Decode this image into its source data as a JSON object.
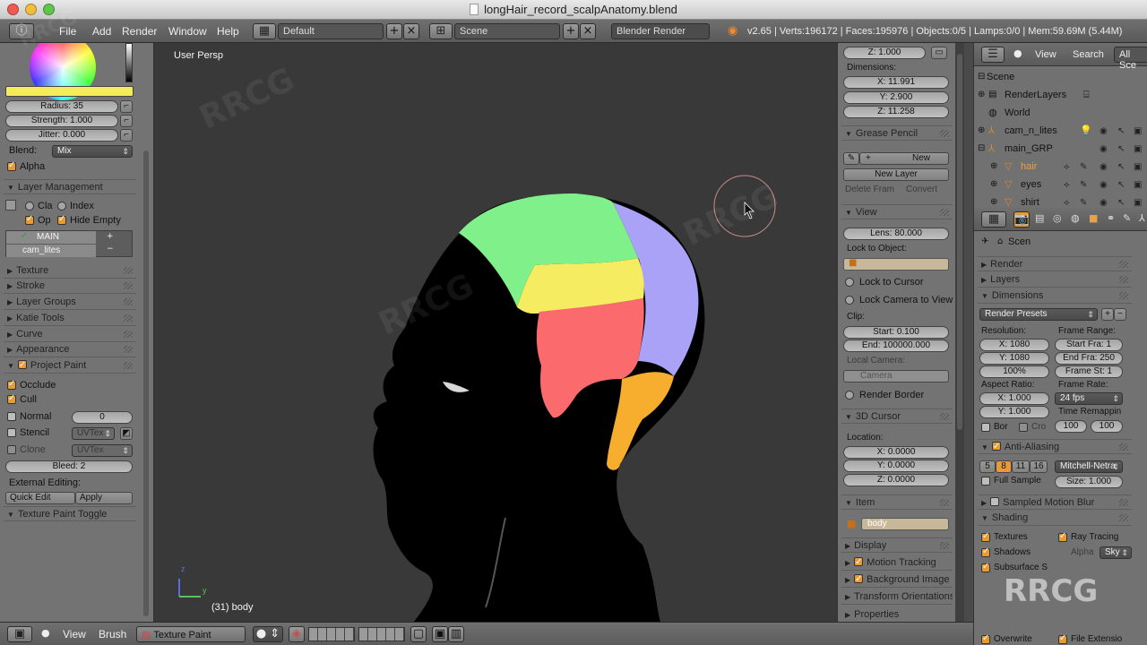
{
  "titlebar": {
    "title": "longHair_record_scalpAnatomy.blend"
  },
  "infobar": {
    "menus": [
      "File",
      "Add",
      "Render",
      "Window",
      "Help"
    ],
    "screen_layout": "Default",
    "scene": "Scene",
    "render_engine": "Blender Render",
    "stats": "v2.65 | Verts:196172 | Faces:195976 | Objects:0/5 | Lamps:0/0 | Mem:59.69M (5.44M)"
  },
  "tool_panel": {
    "radius": "Radius: 35",
    "strength": "Strength: 1.000",
    "jitter": "Jitter: 0.000",
    "blend_label": "Blend:",
    "blend_value": "Mix",
    "alpha": "Alpha",
    "layer_management": "Layer Management",
    "cla": "Cla",
    "index": "Index",
    "op": "Op",
    "hide_empty": "Hide Empty",
    "layers": [
      "MAIN",
      "cam_lites"
    ],
    "sections_a": [
      "Texture",
      "Stroke",
      "Layer Groups",
      "Katie Tools",
      "Curve",
      "Appearance"
    ],
    "project_paint": "Project Paint",
    "occlude": "Occlude",
    "cull": "Cull",
    "normal": "Normal",
    "normal_value": "0",
    "stencil": "Stencil",
    "stencil_layer": "UVTex",
    "clone": "Clone",
    "clone_layer": "UVTex",
    "bleed": "Bleed: 2",
    "external_editing": "External Editing:",
    "quick_edit": "Quick Edit",
    "apply": "Apply",
    "texture_paint_toggle": "Texture Paint Toggle",
    "brush_color": "#f4ec5a"
  },
  "viewport": {
    "label": "User Persp",
    "object_info": "(31) body",
    "axis_z": "z",
    "axis_y": "y"
  },
  "n_panel": {
    "z_top": "Z: 1.000",
    "dimensions": "Dimensions:",
    "dim_x": "X: 11.991",
    "dim_y": "Y: 2.900",
    "dim_z": "Z: 11.258",
    "grease_pencil": "Grease Pencil",
    "new": "New",
    "new_layer": "New Layer",
    "delete_frame": "Delete Fram",
    "convert": "Convert",
    "view": "View",
    "lens": "Lens: 80.000",
    "lock_to_object": "Lock to Object:",
    "lock_to_cursor": "Lock to Cursor",
    "lock_camera_to_view": "Lock Camera to View",
    "clip": "Clip:",
    "clip_start": "Start: 0.100",
    "clip_end": "End: 100000.000",
    "local_camera": "Local Camera:",
    "camera": "Camera",
    "render_border": "Render Border",
    "cursor_3d": "3D Cursor",
    "location": "Location:",
    "loc_x": "X: 0.0000",
    "loc_y": "Y: 0.0000",
    "loc_z": "Z: 0.0000",
    "item": "Item",
    "item_name": "body",
    "display": "Display",
    "motion_tracking": "Motion Tracking",
    "background_images": "Background Image",
    "transform_orientations": "Transform Orientations",
    "properties": "Properties"
  },
  "outliner": {
    "view": "View",
    "search": "Search",
    "all_scenes": "All Sce",
    "items": [
      "Scene",
      "RenderLayers",
      "World",
      "cam_n_lites",
      "main_GRP",
      "hair",
      "eyes",
      "shirt"
    ]
  },
  "properties": {
    "context": "Scen",
    "render": "Render",
    "layers": "Layers",
    "dimensions": "Dimensions",
    "render_presets": "Render Presets",
    "resolution": "Resolution:",
    "res_x": "X: 1080",
    "res_y": "Y: 1080",
    "res_pct": "100%",
    "frame_range": "Frame Range:",
    "start_frame": "Start Fra: 1",
    "end_frame": "End Fra: 250",
    "frame_step": "Frame St: 1",
    "aspect_ratio": "Aspect Ratio:",
    "asp_x": "X: 1.000",
    "asp_y": "Y: 1.000",
    "frame_rate": "Frame Rate:",
    "fps": "24 fps",
    "time_remapping": "Time Remappin",
    "remap_old": "100",
    "remap_new": "100",
    "border": "Bor",
    "crop": "Cro",
    "anti_aliasing": "Anti-Aliasing",
    "aa_samples": [
      "5",
      "8",
      "11",
      "16"
    ],
    "aa_filter": "Mitchell-Netra",
    "full_sample": "Full Sample",
    "filter_size": "Size: 1.000",
    "sampled_motion_blur": "Sampled Motion Blur",
    "shading": "Shading",
    "textures": "Textures",
    "ray_tracing": "Ray Tracing",
    "shadows": "Shadows",
    "alpha_label": "Alpha",
    "alpha_value": "Sky",
    "subsurface": "Subsurface S",
    "overwrite": "Overwrite",
    "file_extensions": "File Extensio"
  },
  "bottombar": {
    "view": "View",
    "brush": "Brush",
    "mode": "Texture Paint"
  },
  "colors": {
    "head": "#000000",
    "region_green": "#7ff08a",
    "region_yellow": "#f6ec62",
    "region_red": "#fb6a6c",
    "region_purple": "#a9a2f6",
    "region_orange": "#f7ae2e",
    "viewport_bg": "#393939",
    "accent": "#e89a35"
  },
  "watermark": "RRCG"
}
